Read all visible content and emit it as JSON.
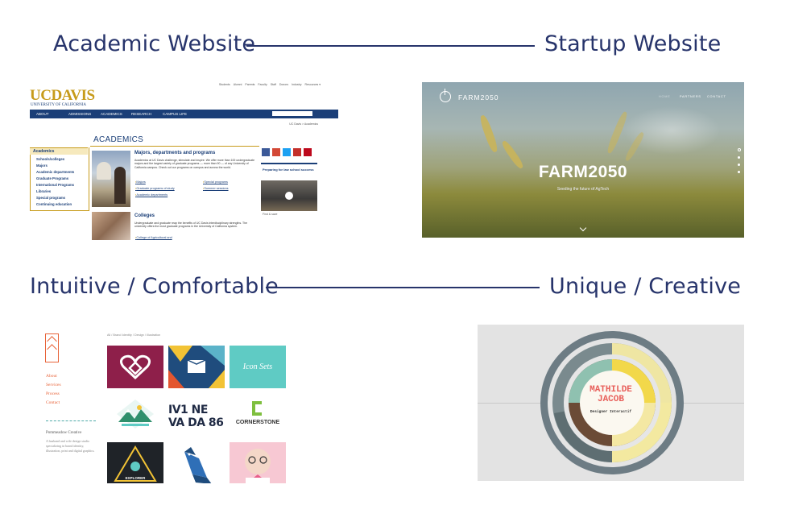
{
  "headings": {
    "academic": "Academic Website",
    "startup": "Startup Website",
    "intuitive": "Intuitive / Comfortable",
    "unique": "Unique / Creative"
  },
  "colors": {
    "heading": "#27346b",
    "ucd_blue": "#1b3f78",
    "ucd_gold": "#c79b1b",
    "pom_orange": "#e8643a",
    "mj_coral": "#e85f5a"
  },
  "ucdavis": {
    "top_links": [
      "Students",
      "Alumni",
      "Parents",
      "Faculty",
      "Staff",
      "Donors",
      "Industry",
      "Resources ▾"
    ],
    "logo": "UCDAVIS",
    "logo_sub": "UNIVERSITY OF CALIFORNIA",
    "nav": [
      "ABOUT",
      "ADMISSIONS",
      "ACADEMICS",
      "RESEARCH",
      "CAMPUS LIFE"
    ],
    "breadcrumb": "UC Davis > Academics",
    "page_title": "ACADEMICS",
    "sidebar_heading": "Academics",
    "sidebar_items": [
      "Schools/colleges",
      "Majors",
      "Academic departments",
      "Graduate Programs",
      "International Programs",
      "Libraries",
      "Special programs",
      "Continuing education"
    ],
    "majors_heading": "Majors, departments and programs",
    "majors_body": "Academics at UC Davis challenge, stimulate and inspire. We offer more than 100 undergraduate majors and the largest variety of graduate programs — more than 90 — of any University of California campus. Check out our programs on campus and across the world.",
    "links_left": [
      "Majors",
      "Graduate programs of study",
      "Academic departments"
    ],
    "links_right": [
      "Special programs",
      "Summer sessions"
    ],
    "colleges_heading": "Colleges",
    "colleges_body": "Undergraduate and graduate reap the benefits of UC Davis interdisciplinary strengths. The university offers the most graduate programs in the University of California system.",
    "colleges_link": "College of Agricultural and",
    "promo": "Preparing for law school success",
    "video_caption": "Find & save"
  },
  "farm": {
    "logo": "FARM2050",
    "nav": [
      "HOME",
      "PARTNERS",
      "CONTACT"
    ],
    "title": "FARM2050",
    "tagline": "Seeding the future of AgTech"
  },
  "pommeadow": {
    "menu": [
      "About",
      "Services",
      "Process",
      "Contact"
    ],
    "about_heading": "Pommeadow Creative",
    "about_text": "A husband and wife design studio specializing in brand identity, illustration, print and digital graphics.",
    "filters": "All  /  Brand Identity  /  Design  /  Illustration",
    "tiles": [
      "",
      "",
      "Icon Sets",
      "",
      "IV1 NE VA DA 86",
      "CORNERSTONE",
      "EXPLORER",
      "",
      ""
    ]
  },
  "mathilde": {
    "name_line1": "MATHILDE",
    "name_line2": "JACOB",
    "role": "Designer Interactif"
  }
}
